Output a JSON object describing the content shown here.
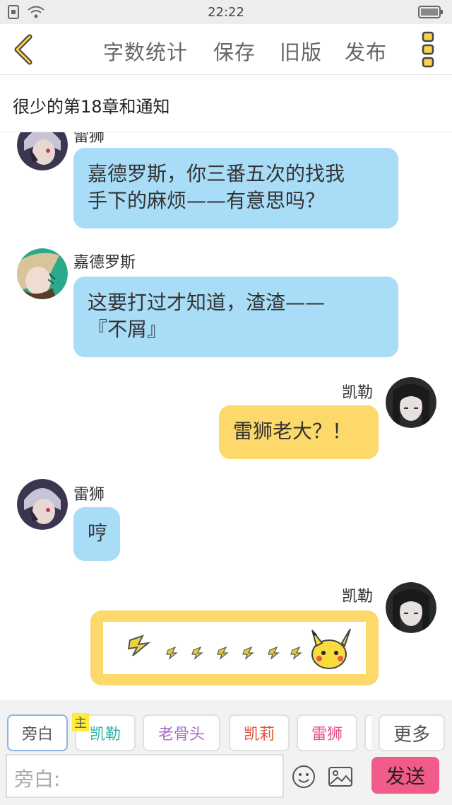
{
  "status_bar": {
    "time": "22:22"
  },
  "toolbar": {
    "word_count_label": "字数统计",
    "save_label": "保存",
    "old_version_label": "旧版",
    "publish_label": "发布"
  },
  "chapter_title": "很少的第18章和通知",
  "messages": [
    {
      "speaker": "雷狮",
      "side": "left",
      "color": "blue",
      "text_lines": [
        "嘉德罗斯，你三番五次的找我",
        "手下的麻烦——有意思吗？"
      ]
    },
    {
      "speaker": "嘉德罗斯",
      "side": "left",
      "color": "blue",
      "text_lines": [
        "这要打过才知道，渣渣——",
        "『不屑』"
      ]
    },
    {
      "speaker": "凯勒",
      "side": "right",
      "color": "yellow",
      "text_lines": [
        "雷狮老大？！"
      ]
    },
    {
      "speaker": "雷狮",
      "side": "left",
      "color": "blue",
      "text_lines": [
        "哼"
      ]
    },
    {
      "speaker": "凯勒",
      "side": "right",
      "color": "yellow",
      "sticker": "pikachu-lightning-sticker"
    }
  ],
  "character_chips": [
    {
      "label": "旁白",
      "color": "#555555",
      "active": true
    },
    {
      "label": "凯勒",
      "color": "#35b5a6",
      "active": false
    },
    {
      "label": "老骨头",
      "color": "#a86ec7",
      "active": false
    },
    {
      "label": "凯莉",
      "color": "#e5533d",
      "active": false
    },
    {
      "label": "雷狮",
      "color": "#e0508a",
      "active": false
    }
  ],
  "host_tag": "主",
  "more_label": "更多",
  "input": {
    "placeholder": "旁白:"
  },
  "send_label": "发送",
  "colors": {
    "accent_yellow": "#fdd96b",
    "bubble_blue": "#a9dcf6",
    "send_pink": "#f15b8a"
  }
}
